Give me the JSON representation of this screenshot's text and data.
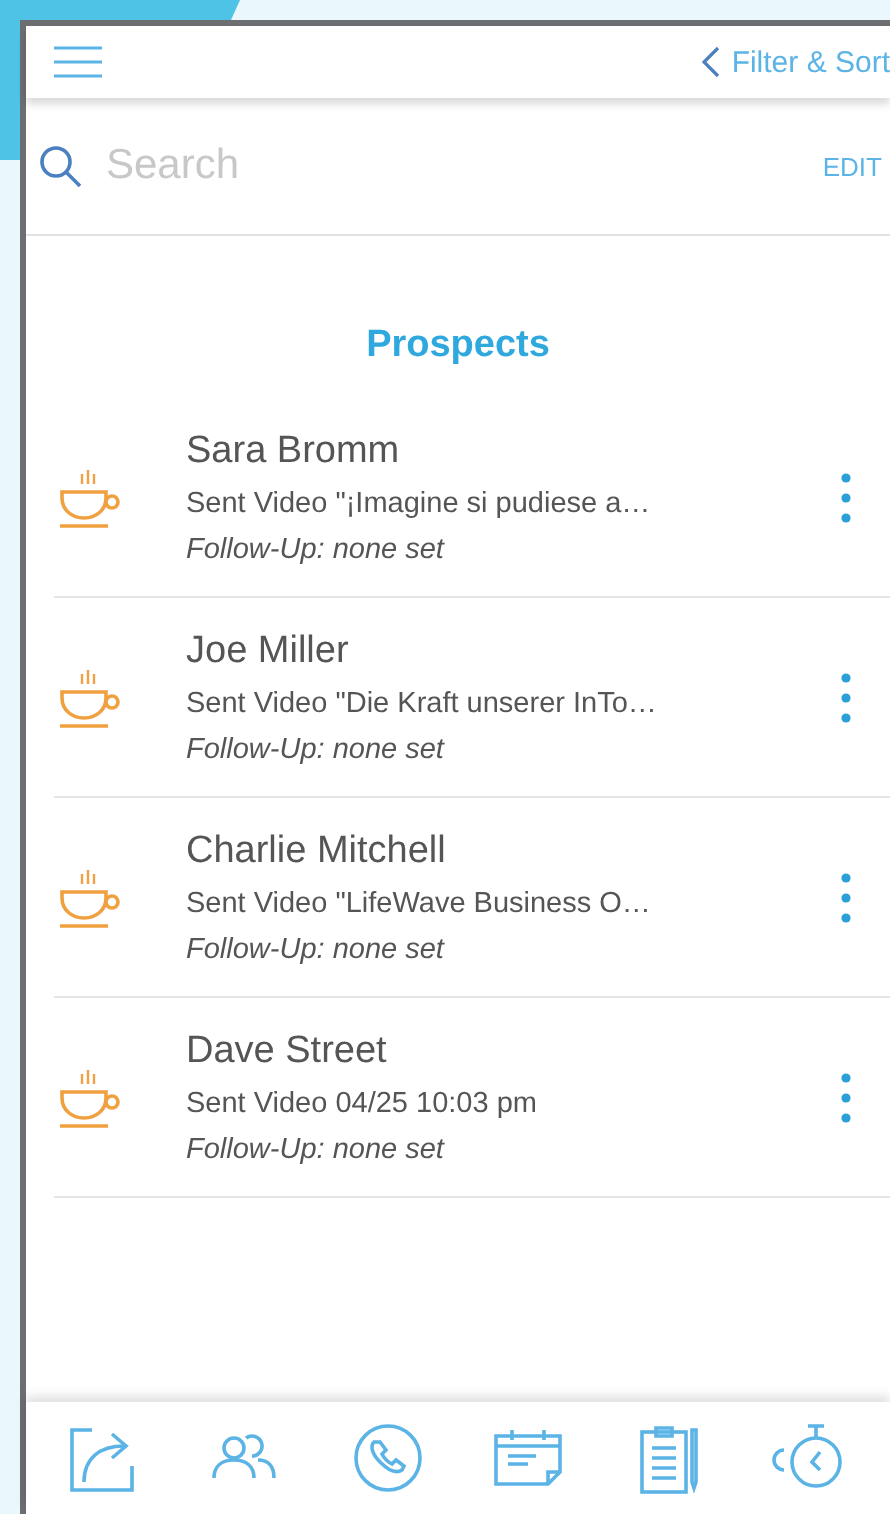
{
  "header": {
    "back_link": "Filter & Sort"
  },
  "search": {
    "placeholder": "Search",
    "action": "EDIT"
  },
  "title": "Prospects",
  "prospects": [
    {
      "name": "Sara Bromm",
      "activity": "Sent Video \"¡Imagine si pudiese a…",
      "follow_up": "Follow-Up: none set"
    },
    {
      "name": "Joe Miller",
      "activity": "Sent Video \"Die Kraft unserer InTo…",
      "follow_up": "Follow-Up: none set"
    },
    {
      "name": "Charlie Mitchell",
      "activity": "Sent Video \"LifeWave Business O…",
      "follow_up": "Follow-Up: none set"
    },
    {
      "name": "Dave Street",
      "activity": "Sent Video  04/25 10:03 pm",
      "follow_up": "Follow-Up: none set"
    }
  ]
}
